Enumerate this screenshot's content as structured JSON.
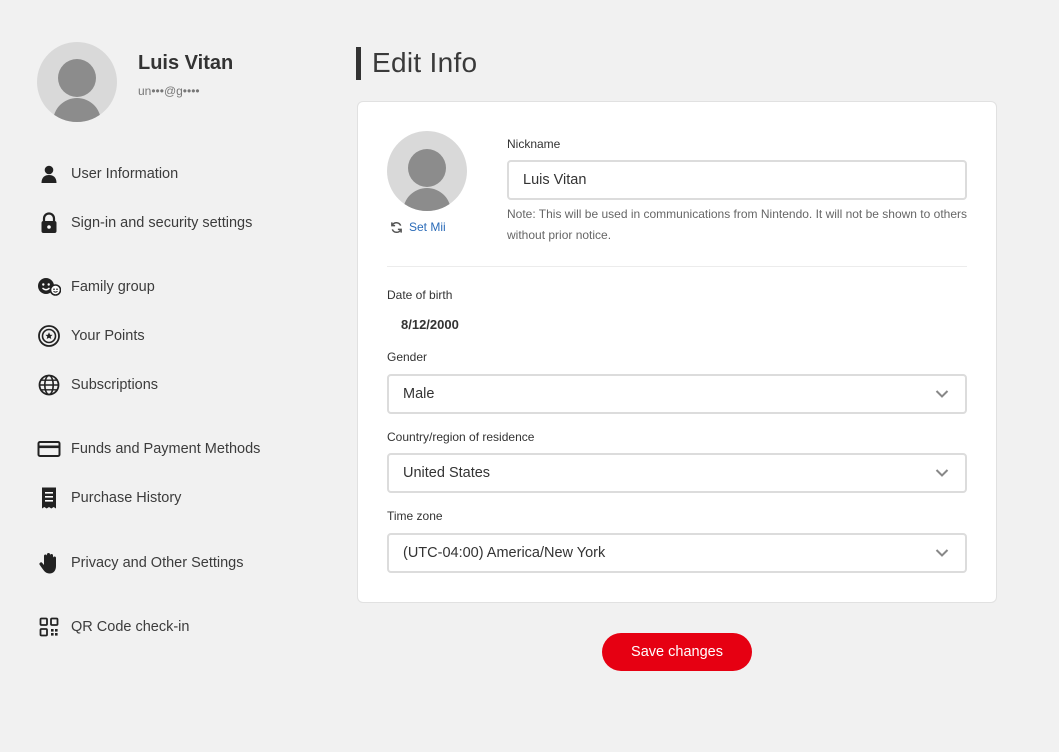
{
  "profile": {
    "name": "Luis Vitan",
    "email": "un•••@g••••"
  },
  "sidebar": {
    "items": [
      {
        "label": "User Information",
        "icon": "person-icon"
      },
      {
        "label": "Sign-in and security settings",
        "icon": "lock-icon"
      },
      {
        "label": "Family group",
        "icon": "family-icon"
      },
      {
        "label": "Your Points",
        "icon": "points-icon"
      },
      {
        "label": "Subscriptions",
        "icon": "globe-icon"
      },
      {
        "label": "Funds and Payment Methods",
        "icon": "credit-card-icon"
      },
      {
        "label": "Purchase History",
        "icon": "receipt-icon"
      },
      {
        "label": "Privacy and Other Settings",
        "icon": "hand-icon"
      },
      {
        "label": "QR Code check-in",
        "icon": "qr-code-icon"
      }
    ]
  },
  "main": {
    "title": "Edit Info",
    "set_mii": "Set Mii",
    "nickname": {
      "label": "Nickname",
      "value": "Luis Vitan",
      "note": "Note: This will be used in communications from Nintendo. It will not be shown to others without prior notice."
    },
    "dob": {
      "label": "Date of birth",
      "value": "8/12/2000"
    },
    "gender": {
      "label": "Gender",
      "value": "Male"
    },
    "country": {
      "label": "Country/region of residence",
      "value": "United States"
    },
    "timezone": {
      "label": "Time zone",
      "value": "(UTC-04:00) America/New York"
    },
    "save_label": "Save changes"
  },
  "colors": {
    "accent": "#e60012",
    "link": "#2a6bb8",
    "background": "#f1f1f1"
  }
}
